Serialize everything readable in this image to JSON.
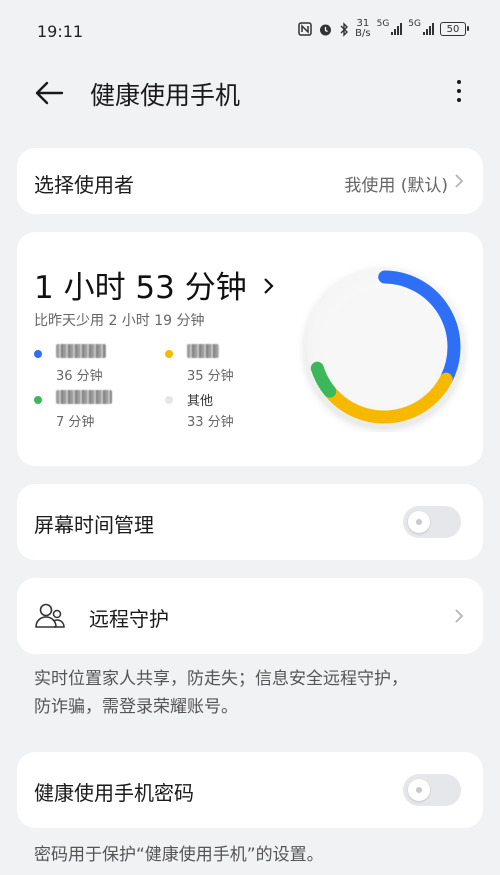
{
  "status": {
    "time": "19:11",
    "speed_value": "31",
    "speed_unit": "B/s",
    "sim1": "5G",
    "sim2": "5G",
    "battery": "50"
  },
  "header": {
    "title": "健康使用手机"
  },
  "user_row": {
    "label": "选择使用者",
    "value": "我使用 (默认)"
  },
  "usage": {
    "total": "1 小时 53 分钟",
    "compare": "比昨天少用 2 小时 19 分钟",
    "apps": [
      {
        "name": "",
        "time": "36 分钟",
        "color": "#2f6ff5"
      },
      {
        "name": "",
        "time": "35 分钟",
        "color": "#f6b900"
      },
      {
        "name": "",
        "time": "7 分钟",
        "color": "#3cb85a"
      },
      {
        "name": "其他",
        "time": "33 分钟",
        "color": "#e5e5e5"
      }
    ]
  },
  "screen_time": {
    "label": "屏幕时间管理",
    "enabled": false
  },
  "remote_guard": {
    "label": "远程守护",
    "desc_line1": "实时位置家人共享，防走失；信息安全远程守护，",
    "desc_line2": "防诈骗，需登录荣耀账号。"
  },
  "password": {
    "label": "健康使用手机密码",
    "enabled": false,
    "desc": "密码用于保护“健康使用手机”的设置。"
  }
}
